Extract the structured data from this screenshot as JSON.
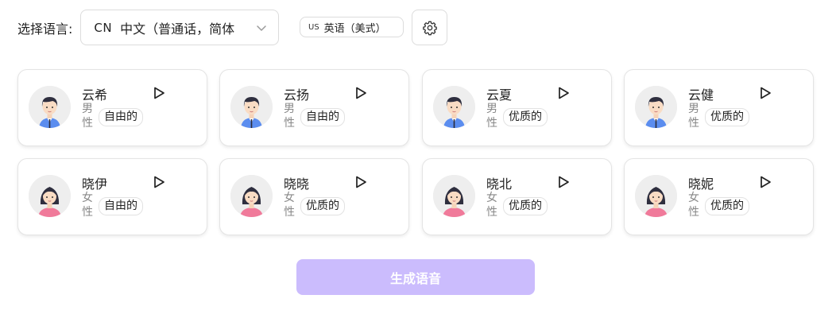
{
  "language": {
    "label": "选择语言:",
    "selected_code": "CN",
    "selected_value": "中文（普通话，简体"
  },
  "accent": {
    "code": "US",
    "value": "英语（美式）"
  },
  "voices": [
    {
      "name": "云希",
      "gender": "男性",
      "tag": "自由的",
      "avatar": "male"
    },
    {
      "name": "云扬",
      "gender": "男性",
      "tag": "自由的",
      "avatar": "male"
    },
    {
      "name": "云夏",
      "gender": "男性",
      "tag": "优质的",
      "avatar": "male"
    },
    {
      "name": "云健",
      "gender": "男性",
      "tag": "优质的",
      "avatar": "male"
    },
    {
      "name": "晓伊",
      "gender": "女性",
      "tag": "自由的",
      "avatar": "female"
    },
    {
      "name": "晓晓",
      "gender": "女性",
      "tag": "优质的",
      "avatar": "female"
    },
    {
      "name": "晓北",
      "gender": "女性",
      "tag": "优质的",
      "avatar": "female"
    },
    {
      "name": "晓妮",
      "gender": "女性",
      "tag": "优质的",
      "avatar": "female"
    }
  ],
  "generate_button": {
    "label": "生成语音"
  },
  "colors": {
    "accent_disabled": "#cbbcfd",
    "male_shirt": "#5b8def",
    "female_shirt": "#f07a9a"
  }
}
